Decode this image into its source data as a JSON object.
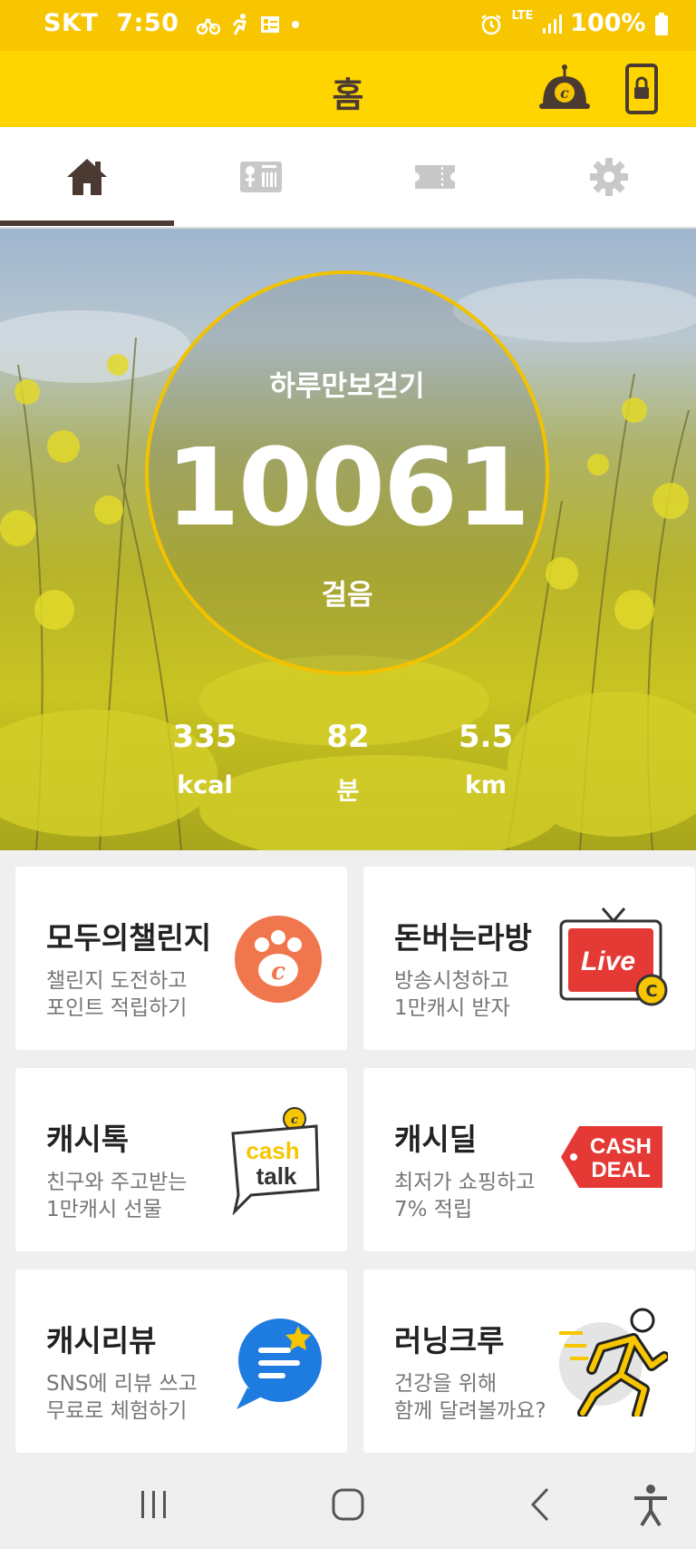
{
  "status_bar": {
    "carrier": "SKT",
    "time": "7:50",
    "network": "LTE",
    "battery": "100%"
  },
  "app_bar": {
    "title": "홈"
  },
  "tabs": [
    {
      "name": "home",
      "icon": "home-icon",
      "active": true
    },
    {
      "name": "shop",
      "icon": "shop-icon",
      "active": false
    },
    {
      "name": "ticket",
      "icon": "ticket-icon",
      "active": false
    },
    {
      "name": "settings",
      "icon": "gear-icon",
      "active": false
    }
  ],
  "pedometer": {
    "label": "하루만보걷기",
    "steps": "10061",
    "unit": "걸음",
    "stats": [
      {
        "value": "335",
        "unit": "kcal"
      },
      {
        "value": "82",
        "unit": "분"
      },
      {
        "value": "5.5",
        "unit": "km"
      }
    ]
  },
  "cards": [
    {
      "title": "모두의챌린지",
      "line1": "챌린지 도전하고",
      "line2": "포인트 적립하기",
      "icon": "paw-coin-icon"
    },
    {
      "title": "돈버는라방",
      "line1": "방송시청하고",
      "line2": "1만캐시 받자",
      "icon": "live-tv-icon",
      "badge": "Live"
    },
    {
      "title": "캐시톡",
      "line1": "친구와 주고받는",
      "line2": "1만캐시 선물",
      "icon": "cash-talk-icon",
      "badge_top": "cash",
      "badge_bottom": "talk"
    },
    {
      "title": "캐시딜",
      "line1": "최저가 쇼핑하고",
      "line2": "7% 적립",
      "icon": "cash-deal-tag-icon",
      "badge_top": "CASH",
      "badge_bottom": "DEAL"
    },
    {
      "title": "캐시리뷰",
      "line1": "SNS에 리뷰 쓰고",
      "line2": "무료로 체험하기",
      "icon": "review-chat-icon"
    },
    {
      "title": "러닝크루",
      "line1": "건강을 위해",
      "line2": "함께 달려볼까요?",
      "icon": "runner-icon"
    }
  ],
  "colors": {
    "brand_yellow": "#ffd500",
    "status_yellow": "#f7c600",
    "ring": "#f2c200",
    "text_dark": "#4a3a32"
  }
}
